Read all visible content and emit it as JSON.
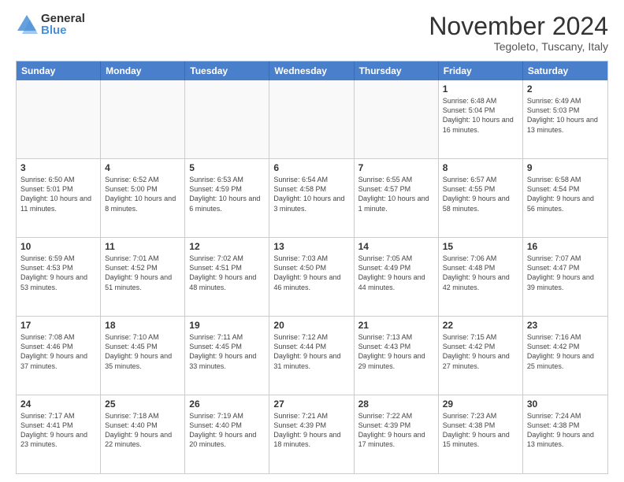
{
  "logo": {
    "general": "General",
    "blue": "Blue"
  },
  "title": "November 2024",
  "subtitle": "Tegoleto, Tuscany, Italy",
  "header_days": [
    "Sunday",
    "Monday",
    "Tuesday",
    "Wednesday",
    "Thursday",
    "Friday",
    "Saturday"
  ],
  "weeks": [
    [
      {
        "day": "",
        "info": ""
      },
      {
        "day": "",
        "info": ""
      },
      {
        "day": "",
        "info": ""
      },
      {
        "day": "",
        "info": ""
      },
      {
        "day": "",
        "info": ""
      },
      {
        "day": "1",
        "info": "Sunrise: 6:48 AM\nSunset: 5:04 PM\nDaylight: 10 hours and 16 minutes."
      },
      {
        "day": "2",
        "info": "Sunrise: 6:49 AM\nSunset: 5:03 PM\nDaylight: 10 hours and 13 minutes."
      }
    ],
    [
      {
        "day": "3",
        "info": "Sunrise: 6:50 AM\nSunset: 5:01 PM\nDaylight: 10 hours and 11 minutes."
      },
      {
        "day": "4",
        "info": "Sunrise: 6:52 AM\nSunset: 5:00 PM\nDaylight: 10 hours and 8 minutes."
      },
      {
        "day": "5",
        "info": "Sunrise: 6:53 AM\nSunset: 4:59 PM\nDaylight: 10 hours and 6 minutes."
      },
      {
        "day": "6",
        "info": "Sunrise: 6:54 AM\nSunset: 4:58 PM\nDaylight: 10 hours and 3 minutes."
      },
      {
        "day": "7",
        "info": "Sunrise: 6:55 AM\nSunset: 4:57 PM\nDaylight: 10 hours and 1 minute."
      },
      {
        "day": "8",
        "info": "Sunrise: 6:57 AM\nSunset: 4:55 PM\nDaylight: 9 hours and 58 minutes."
      },
      {
        "day": "9",
        "info": "Sunrise: 6:58 AM\nSunset: 4:54 PM\nDaylight: 9 hours and 56 minutes."
      }
    ],
    [
      {
        "day": "10",
        "info": "Sunrise: 6:59 AM\nSunset: 4:53 PM\nDaylight: 9 hours and 53 minutes."
      },
      {
        "day": "11",
        "info": "Sunrise: 7:01 AM\nSunset: 4:52 PM\nDaylight: 9 hours and 51 minutes."
      },
      {
        "day": "12",
        "info": "Sunrise: 7:02 AM\nSunset: 4:51 PM\nDaylight: 9 hours and 48 minutes."
      },
      {
        "day": "13",
        "info": "Sunrise: 7:03 AM\nSunset: 4:50 PM\nDaylight: 9 hours and 46 minutes."
      },
      {
        "day": "14",
        "info": "Sunrise: 7:05 AM\nSunset: 4:49 PM\nDaylight: 9 hours and 44 minutes."
      },
      {
        "day": "15",
        "info": "Sunrise: 7:06 AM\nSunset: 4:48 PM\nDaylight: 9 hours and 42 minutes."
      },
      {
        "day": "16",
        "info": "Sunrise: 7:07 AM\nSunset: 4:47 PM\nDaylight: 9 hours and 39 minutes."
      }
    ],
    [
      {
        "day": "17",
        "info": "Sunrise: 7:08 AM\nSunset: 4:46 PM\nDaylight: 9 hours and 37 minutes."
      },
      {
        "day": "18",
        "info": "Sunrise: 7:10 AM\nSunset: 4:45 PM\nDaylight: 9 hours and 35 minutes."
      },
      {
        "day": "19",
        "info": "Sunrise: 7:11 AM\nSunset: 4:45 PM\nDaylight: 9 hours and 33 minutes."
      },
      {
        "day": "20",
        "info": "Sunrise: 7:12 AM\nSunset: 4:44 PM\nDaylight: 9 hours and 31 minutes."
      },
      {
        "day": "21",
        "info": "Sunrise: 7:13 AM\nSunset: 4:43 PM\nDaylight: 9 hours and 29 minutes."
      },
      {
        "day": "22",
        "info": "Sunrise: 7:15 AM\nSunset: 4:42 PM\nDaylight: 9 hours and 27 minutes."
      },
      {
        "day": "23",
        "info": "Sunrise: 7:16 AM\nSunset: 4:42 PM\nDaylight: 9 hours and 25 minutes."
      }
    ],
    [
      {
        "day": "24",
        "info": "Sunrise: 7:17 AM\nSunset: 4:41 PM\nDaylight: 9 hours and 23 minutes."
      },
      {
        "day": "25",
        "info": "Sunrise: 7:18 AM\nSunset: 4:40 PM\nDaylight: 9 hours and 22 minutes."
      },
      {
        "day": "26",
        "info": "Sunrise: 7:19 AM\nSunset: 4:40 PM\nDaylight: 9 hours and 20 minutes."
      },
      {
        "day": "27",
        "info": "Sunrise: 7:21 AM\nSunset: 4:39 PM\nDaylight: 9 hours and 18 minutes."
      },
      {
        "day": "28",
        "info": "Sunrise: 7:22 AM\nSunset: 4:39 PM\nDaylight: 9 hours and 17 minutes."
      },
      {
        "day": "29",
        "info": "Sunrise: 7:23 AM\nSunset: 4:38 PM\nDaylight: 9 hours and 15 minutes."
      },
      {
        "day": "30",
        "info": "Sunrise: 7:24 AM\nSunset: 4:38 PM\nDaylight: 9 hours and 13 minutes."
      }
    ]
  ]
}
